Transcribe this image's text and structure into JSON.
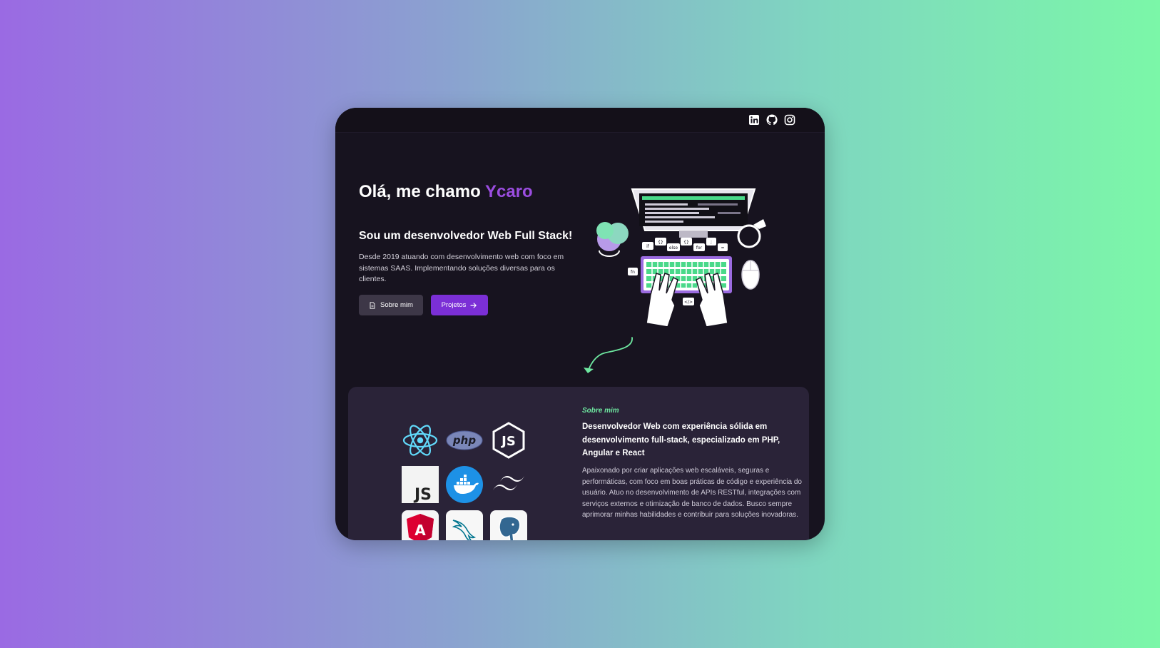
{
  "header": {
    "socials": [
      {
        "name": "LinkedIn",
        "icon": "linkedin-icon"
      },
      {
        "name": "GitHub",
        "icon": "github-icon"
      },
      {
        "name": "Instagram",
        "icon": "instagram-icon"
      }
    ]
  },
  "hero": {
    "greeting_prefix": "Olá, me chamo ",
    "name": "Ycaro",
    "name_color": "#9b4de0",
    "subtitle": "Sou um desenvolvedor Web Full Stack!",
    "description": "Desde 2019 atuando com desenvolvimento web com foco em sistemas SAAS. Implementando soluções diversas para os clientes.",
    "buttons": {
      "about_label": "Sobre mim",
      "projects_label": "Projetos"
    },
    "illustration": {
      "code_tags": [
        "if",
        "{}",
        "else",
        "{}",
        "for",
        ";",
        "=",
        "fn",
        "</>"
      ]
    }
  },
  "about": {
    "tag": "Sobre mim",
    "heading": "Desenvolvedor Web com experiência sólida em desenvolvimento full-stack, especializado em PHP, Angular e React",
    "text": "Apaixonado por criar aplicações web escaláveis, seguras e performáticas, com foco em boas práticas de código e experiência do usuário. Atuo no desenvolvimento de APIs RESTful, integrações com serviços externos e otimização de banco de dados. Busco sempre aprimorar minhas habilidades e contribuir para soluções inovadoras.",
    "techs": [
      {
        "name": "React",
        "icon": "react-icon"
      },
      {
        "name": "PHP",
        "label": "php",
        "icon": "php-icon"
      },
      {
        "name": "Node.js",
        "label": "JS",
        "icon": "nodejs-icon"
      },
      {
        "name": "JavaScript",
        "label": "JS",
        "icon": "javascript-icon"
      },
      {
        "name": "Docker",
        "icon": "docker-icon"
      },
      {
        "name": "Tailwind CSS",
        "icon": "tailwind-icon"
      },
      {
        "name": "Angular",
        "label": "A",
        "icon": "angular-icon"
      },
      {
        "name": "MySQL",
        "icon": "mysql-icon"
      },
      {
        "name": "PostgreSQL",
        "icon": "postgresql-icon"
      }
    ]
  },
  "colors": {
    "background_gradient": [
      "#9a6ae3",
      "#7bf7a8"
    ],
    "window": "#17131f",
    "card": "#2a2338",
    "accent": "#7b2fd6",
    "tag": "#6ee7a0"
  }
}
